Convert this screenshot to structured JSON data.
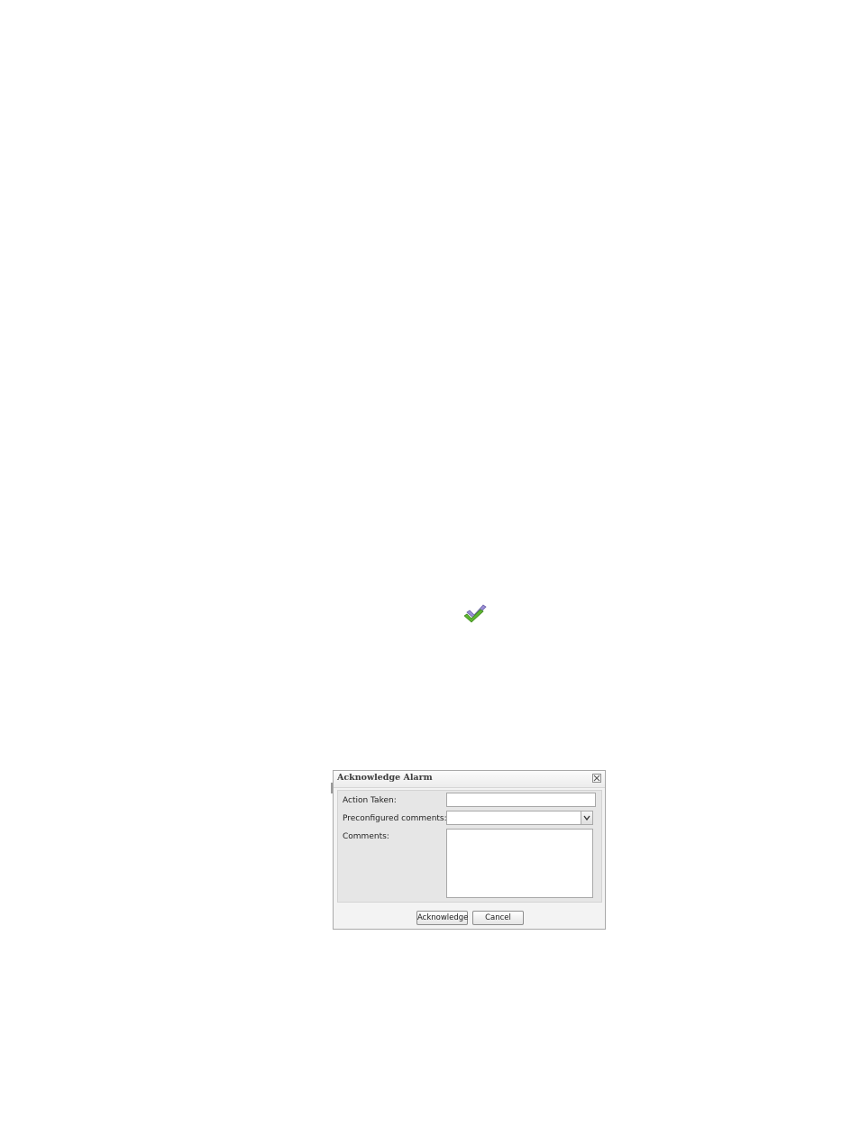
{
  "inline_icon": {
    "name": "acknowledge-icon",
    "colors": {
      "front_check": "#5cb130",
      "back_check": "#8e7fc9"
    }
  },
  "dialog": {
    "title": "Acknowledge Alarm",
    "close_icon": "close-icon",
    "fields": {
      "action_taken": {
        "label": "Action Taken:",
        "value": ""
      },
      "preconfigured_comments": {
        "label": "Preconfigured comments:",
        "value": ""
      },
      "comments": {
        "label": "Comments:",
        "value": ""
      }
    },
    "buttons": {
      "acknowledge": "Acknowledge",
      "cancel": "Cancel"
    }
  }
}
